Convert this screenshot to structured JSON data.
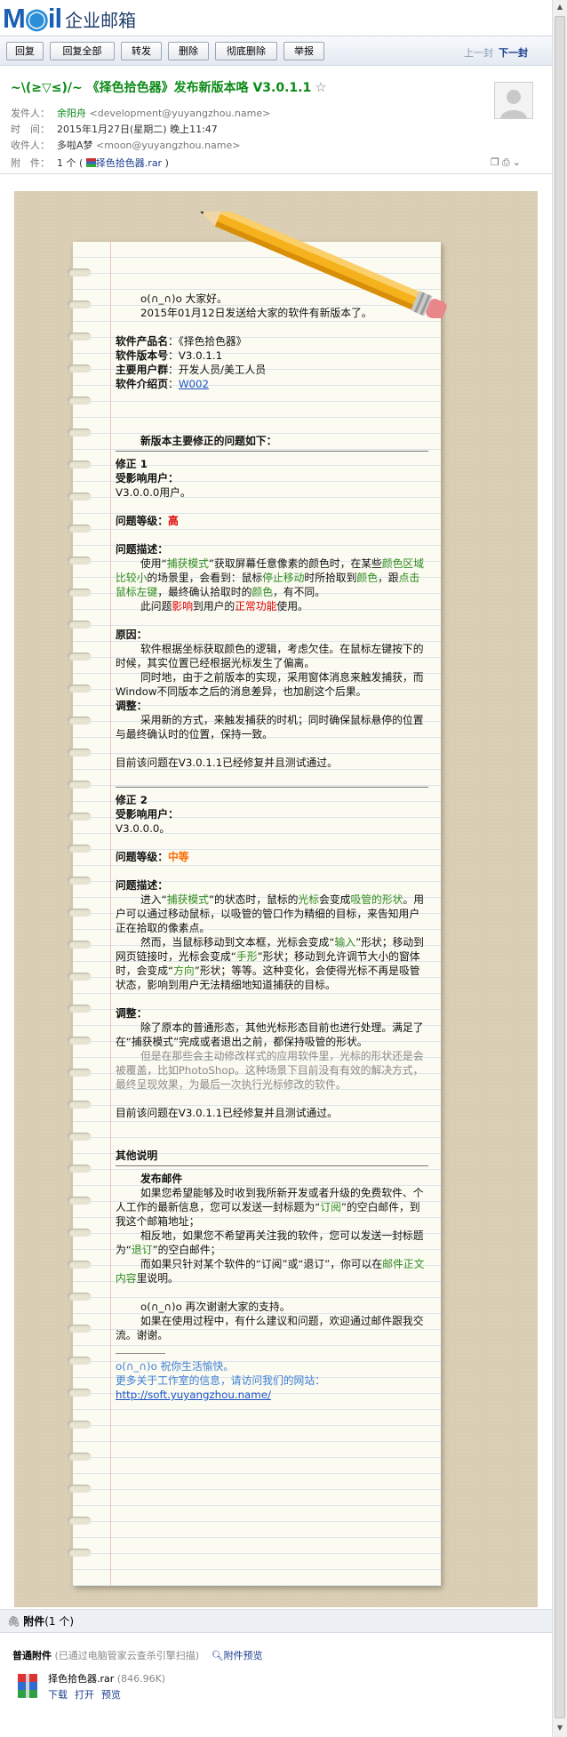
{
  "logo": {
    "mail_a": "M",
    "mail_o": "◉",
    "mail_b": "il",
    "text": "企业邮箱"
  },
  "toolbar": {
    "buttons": [
      "回复",
      "回复全部",
      "转发",
      "删除",
      "彻底删除",
      "举报"
    ],
    "prev": "上一封",
    "next": "下一封"
  },
  "header": {
    "subject": "~\\(≥▽≤)/~ 《择色拾色器》发布新版本咯 V3.0.1.1",
    "star": "☆",
    "from_label": "发件人：",
    "from_name": "余阳舟",
    "from_addr": "<development@yuyangzhou.name>",
    "time_label": "时　间：",
    "time_value": "2015年1月27日(星期二) 晚上11:47",
    "to_label": "收件人：",
    "to_name": "多啦A梦",
    "to_addr": "<moon@yuyangzhou.name>",
    "att_label": "附　件：",
    "att_count": "1 个 (",
    "att_file": "择色拾色器.rar",
    "att_close": ")"
  },
  "letter": {
    "greet1": "o(∩_∩)o  大家好。",
    "greet2": "2015年01月12日发送给大家的软件有新版本了。",
    "pname_l": "软件产品名",
    "pname_v": "：《择色拾色器》",
    "ver_l": "软件版本号",
    "ver_v": "：V3.0.1.1",
    "users_l": "主要用户群",
    "users_v": "：开发人员/美工人员",
    "intro_l": "软件介绍页",
    "intro_c": "：",
    "intro_link": "W002",
    "fix_title": "新版本主要修正的问题如下：",
    "f1_title": "修正 1",
    "f1_users_l": "受影响用户：",
    "f1_users_v": "V3.0.0.0用户。",
    "f1_level_l": "问题等级：",
    "f1_level_v": "高",
    "f1_desc_l": "问题描述：",
    "f1_d1": "使用“",
    "f1_d2": "捕获模式",
    "f1_d3": "”获取屏幕任意像素的颜色时，在某些",
    "f1_d4": "颜色区域比较小",
    "f1_d5": "的场景里，会看到：鼠标",
    "f1_d6": "停止移动",
    "f1_d7": "时所拾取到",
    "f1_d8": "颜色",
    "f1_d9": "，跟",
    "f1_d10": "点击鼠标左键",
    "f1_d11": "，最终确认拾取时的",
    "f1_d12": "颜色",
    "f1_d13": "，有不同。",
    "f1_e1": "此问题",
    "f1_e2": "影响",
    "f1_e3": "到用户的",
    "f1_e4": "正常功能",
    "f1_e5": "使用。",
    "f1_cause_l": "原因：",
    "f1_c1": "软件根据坐标获取颜色的逻辑，考虑欠佳。在鼠标左键按下的时候，其实位置已经根据光标发生了偏离。",
    "f1_c2": "同时地，由于之前版本的实现，采用窗体消息来触发捕获，而Window不同版本之后的消息差异，也加剧这个后果。",
    "f1_adj_l": "调整：",
    "f1_a1": "采用新的方式，来触发捕获的时机；同时确保鼠标悬停的位置与最终确认时的位置，保持一致。",
    "f1_done": "目前该问题在V3.0.1.1已经修复并且测试通过。",
    "f2_title": "修正 2",
    "f2_users_l": "受影响用户：",
    "f2_users_v": "V3.0.0.0。",
    "f2_level_l": "问题等级：",
    "f2_level_v": "中等",
    "f2_desc_l": "问题描述：",
    "f2_d1": "进入“",
    "f2_d2": "捕获模式",
    "f2_d3": "”的状态时，鼠标的",
    "f2_d4": "光标",
    "f2_d5": "会变成",
    "f2_d6": "吸管的形状",
    "f2_d7": "。用户可以通过移动鼠标，以吸管的管口作为精细的目标，来告知用户正在拾取的像素点。",
    "f2_e1": "然而，当鼠标移动到文本框，光标会变成“",
    "f2_e2": "输入",
    "f2_e3": "”形状；移动到网页链接时，光标会变成“",
    "f2_e4": "手形",
    "f2_e5": "”形状；移动到允许调节大小的窗体时，会变成“",
    "f2_e6": "方向",
    "f2_e7": "”形状；等等。这种变化，会使得光标不再是吸管状态，影响到用户无法精细地知道捕获的目标。",
    "f2_adj_l": "调整：",
    "f2_a1": "除了原本的普通形态，其他光标形态目前也进行处理。满足了在“捕获模式”完成或者退出之前，都保持吸管的形状。",
    "f2_a2": "但是在那些会主动修改样式的应用软件里，光标的形状还是会被覆盖，比如PhotoShop。这种场景下目前没有有效的解决方式，最终呈现效果，为最后一次执行光标修改的软件。",
    "f2_done": "目前该问题在V3.0.1.1已经修复并且测试通过。",
    "other_title": "其他说明",
    "pub_title": "发布邮件",
    "pub1": "如果您希望能够及时收到我所新开发或者升级的免费软件、个人工作的最新信息，您可以发送一封标题为“",
    "pub1_sub": "订阅",
    "pub1_end": "”的空白邮件，到我这个邮箱地址；",
    "pub2": "相反地，如果您不希望再关注我的软件，您可以发送一封标题为“",
    "pub2_unsub": "退订",
    "pub2_end": "”的空白邮件；",
    "pub3": "而如果只针对某个软件的“订阅”或“退订”，你可以在",
    "pub3_body": "邮件正文内容",
    "pub3_end": "里说明。",
    "thanks1": "o(∩_∩)o 再次谢谢大家的支持。",
    "thanks2": "如果在使用过程中，有什么建议和问题，欢迎通过邮件跟我交流。谢谢。",
    "sig1": "o(∩_∩)o  祝你生活愉快。",
    "sig2": "更多关于工作室的信息，请访问我们的网站：",
    "sig_link": "http://soft.yuyangzhou.name/"
  },
  "attachments": {
    "title": "附件",
    "count": "(1 个)",
    "section": "普通附件",
    "scan": "(已通过电脑管家云查杀引擎扫描)",
    "preview_all": "附件预览",
    "file_name": "择色拾色器.rar",
    "file_size": "(846.96K)",
    "actions": [
      "下载",
      "打开",
      "预览"
    ]
  }
}
